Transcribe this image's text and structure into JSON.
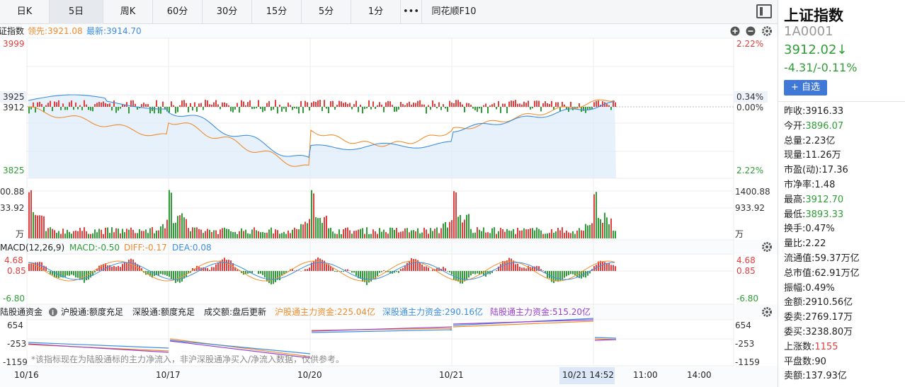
{
  "toolbar": {
    "tabs": [
      "日K",
      "5日",
      "周K",
      "60分",
      "30分",
      "15分",
      "5分",
      "1分",
      "•••",
      "同花顺F10"
    ],
    "active_tab": "5日"
  },
  "price_panel": {
    "title": "证指数",
    "lead_label": "领先:3921.08",
    "latest_label": "最新:3914.70",
    "y_left": [
      "3999",
      "3925",
      "3912",
      "3825"
    ],
    "y_right": [
      "2.22%",
      "0.34%",
      "0.00%",
      "2.22%"
    ]
  },
  "volume_panel": {
    "left_labels": [
      "00.88",
      "33.92",
      "万"
    ],
    "right_labels": [
      "1400.88",
      "933.92",
      "万"
    ]
  },
  "macd_panel": {
    "title": "MACD(12,26,9)",
    "macd_label": "MACD:-0.50",
    "diff_label": "DIFF:-0.17",
    "dea_label": "DEA:0.08",
    "y_left": [
      "4.68",
      "0.85",
      "-6.80"
    ],
    "y_right": [
      "4.68",
      "0.85",
      "-6.80"
    ]
  },
  "flow_panel": {
    "title": "陆股通资金",
    "sh_status": "沪股通:额度充足",
    "sz_status": "深股通:额度充足",
    "turnover_status": "成交额:盘后更新",
    "sh_fund": "沪股通主力资金:225.04亿",
    "sz_fund": "深股通主力资金:290.16亿",
    "total_fund": "陆股通主力资金:515.20亿",
    "note": "*该指标现在为陆股通标的主力净流入，非沪深股通净买入/净流入数据，仅供参考。",
    "y_left": [
      "654",
      "-253",
      "-1159"
    ],
    "y_right": [
      "654",
      "-253",
      "-1159"
    ]
  },
  "x_axis": {
    "dates": [
      "10/16",
      "10/17",
      "10/20",
      "10/21"
    ],
    "cursor_label": "10/21 14:52",
    "times": [
      "11:00",
      "14:00"
    ]
  },
  "stock": {
    "name": "上证指数",
    "code": "1A0001",
    "price": "3912.02↓",
    "change": "-4.31/-0.11%",
    "add_label": "+ 自选"
  },
  "stats": [
    {
      "label": "昨收:",
      "value": "3916.33",
      "tone": "black"
    },
    {
      "label": "今开:",
      "value": "3896.07",
      "tone": "green"
    },
    {
      "label": "总量:",
      "value": "2.23亿",
      "tone": "black"
    },
    {
      "label": "现量:",
      "value": "11.26万",
      "tone": "black"
    },
    {
      "label": "市盈(动):",
      "value": "17.36",
      "tone": "black"
    },
    {
      "label": "市净率:",
      "value": "1.48",
      "tone": "black"
    },
    {
      "label": "最高:",
      "value": "3912.70",
      "tone": "green"
    },
    {
      "label": "最低:",
      "value": "3893.33",
      "tone": "green"
    },
    {
      "label": "换手:",
      "value": "0.47%",
      "tone": "black"
    },
    {
      "label": "量比:",
      "value": "2.22",
      "tone": "black"
    },
    {
      "label": "流通值:",
      "value": "59.37万亿",
      "tone": "black"
    },
    {
      "label": "总市值:",
      "value": "62.91万亿",
      "tone": "black"
    },
    {
      "label": "振幅:",
      "value": "0.49%",
      "tone": "black"
    },
    {
      "label": "金额:",
      "value": "2910.56亿",
      "tone": "black"
    },
    {
      "label": "委卖:",
      "value": "2769.17万",
      "tone": "black"
    },
    {
      "label": "委买:",
      "value": "3238.80万",
      "tone": "black"
    },
    {
      "label": "上涨数:",
      "value": "1155",
      "tone": "red"
    },
    {
      "label": "平盘数:",
      "value": "90",
      "tone": "black"
    },
    {
      "label": "卖额:",
      "value": "137.93亿",
      "tone": "black"
    }
  ],
  "colors": {
    "up": "#e23e3e",
    "down": "#2e9d35",
    "orange": "#f08c2b",
    "blue": "#3d8ee0",
    "purple": "#9b3fcf"
  }
}
